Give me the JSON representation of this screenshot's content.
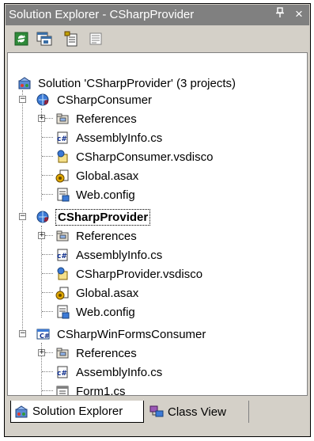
{
  "window": {
    "title": "Solution Explorer - CSharpProvider",
    "pin_glyph": "4",
    "close_glyph": "×"
  },
  "toolbar": {
    "buttons": [
      {
        "name": "refresh-icon"
      },
      {
        "name": "show-all-files-icon"
      },
      {
        "name": "properties-icon"
      },
      {
        "name": "view-code-icon"
      }
    ]
  },
  "tree": {
    "solution": "Solution 'CSharpProvider' (3 projects)",
    "projects": [
      {
        "label": "CSharpConsumer",
        "items": [
          "References",
          "AssemblyInfo.cs",
          "CSharpConsumer.vsdisco",
          "Global.asax",
          "Web.config"
        ]
      },
      {
        "label": "CSharpProvider",
        "items": [
          "References",
          "AssemblyInfo.cs",
          "CSharpProvider.vsdisco",
          "Global.asax",
          "Web.config"
        ]
      },
      {
        "label": "CSharpWinFormsConsumer",
        "items": [
          "References",
          "AssemblyInfo.cs",
          "Form1.cs"
        ]
      }
    ]
  },
  "tabs": {
    "solution_explorer": "Solution Explorer",
    "class_view": "Class View"
  },
  "colors": {
    "titlebar": "#808080",
    "panel": "#d4d0c8"
  }
}
